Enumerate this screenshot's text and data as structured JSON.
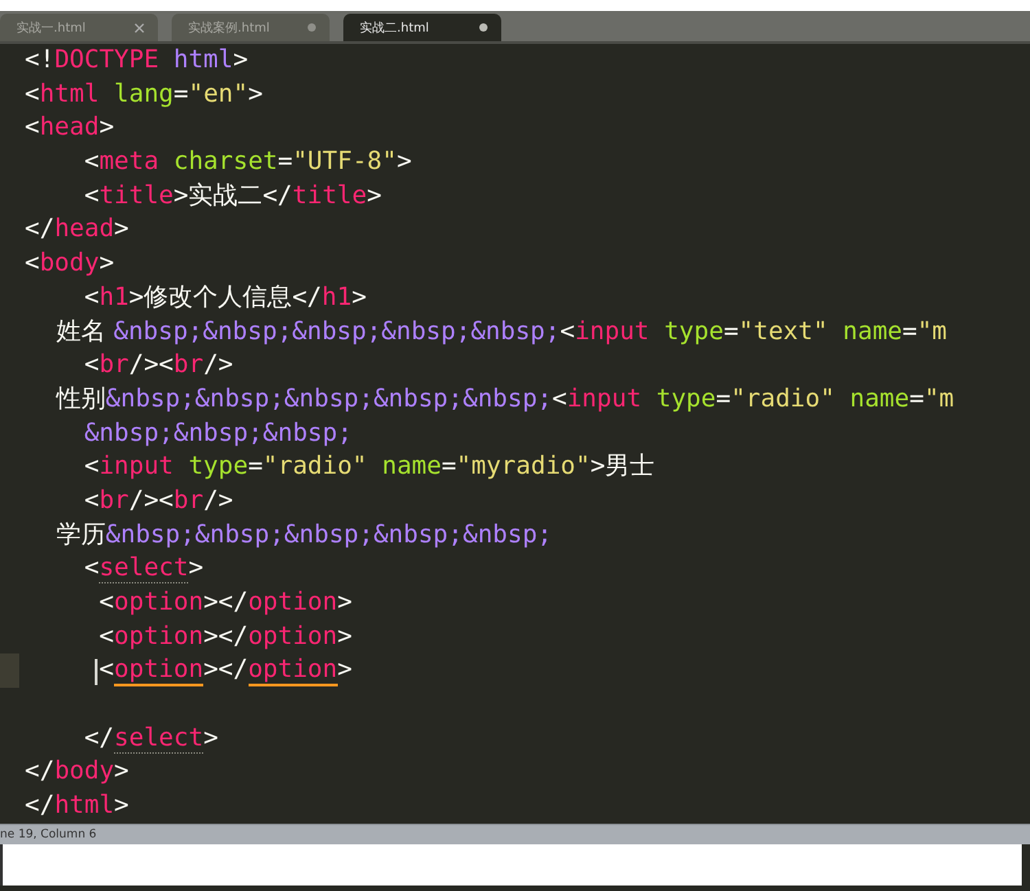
{
  "tabs": [
    {
      "label": "实战一.html",
      "selected": false,
      "modified": false
    },
    {
      "label": "实战案例.html",
      "selected": false,
      "modified": true
    },
    {
      "label": "实战二.html",
      "selected": true,
      "modified": true
    }
  ],
  "editor": {
    "lines": [
      {
        "current": false,
        "tokens": [
          {
            "kind": "punct",
            "text": "<!"
          },
          {
            "kind": "tag",
            "text": "DOCTYPE"
          },
          {
            "kind": "entity",
            "text": " html"
          },
          {
            "kind": "punct",
            "text": ">"
          }
        ]
      },
      {
        "current": false,
        "tokens": [
          {
            "kind": "punct",
            "text": "<"
          },
          {
            "kind": "tag",
            "text": "html"
          },
          {
            "kind": "attr",
            "text": " lang"
          },
          {
            "kind": "punct",
            "text": "="
          },
          {
            "kind": "string",
            "text": "\"en\""
          },
          {
            "kind": "punct",
            "text": ">"
          }
        ]
      },
      {
        "current": false,
        "tokens": [
          {
            "kind": "punct",
            "text": "<"
          },
          {
            "kind": "tag",
            "text": "head"
          },
          {
            "kind": "punct",
            "text": ">"
          }
        ]
      },
      {
        "current": false,
        "tokens": [
          {
            "kind": "punct",
            "text": "    <"
          },
          {
            "kind": "tag",
            "text": "meta"
          },
          {
            "kind": "attr",
            "text": " charset"
          },
          {
            "kind": "punct",
            "text": "="
          },
          {
            "kind": "string",
            "text": "\"UTF-8\""
          },
          {
            "kind": "punct",
            "text": ">"
          }
        ]
      },
      {
        "current": false,
        "tokens": [
          {
            "kind": "punct",
            "text": "    <"
          },
          {
            "kind": "tag",
            "text": "title"
          },
          {
            "kind": "punct",
            "text": ">"
          },
          {
            "kind": "cjk",
            "text": "实战二"
          },
          {
            "kind": "punct",
            "text": "</"
          },
          {
            "kind": "tag",
            "text": "title"
          },
          {
            "kind": "punct",
            "text": ">"
          }
        ]
      },
      {
        "current": false,
        "tokens": [
          {
            "kind": "punct",
            "text": "</"
          },
          {
            "kind": "tag",
            "text": "head"
          },
          {
            "kind": "punct",
            "text": ">"
          }
        ]
      },
      {
        "current": false,
        "tokens": [
          {
            "kind": "punct",
            "text": "<"
          },
          {
            "kind": "tag",
            "text": "body"
          },
          {
            "kind": "punct",
            "text": ">"
          }
        ]
      },
      {
        "current": false,
        "tokens": [
          {
            "kind": "punct",
            "text": "    <"
          },
          {
            "kind": "tag",
            "text": "h1"
          },
          {
            "kind": "punct",
            "text": ">"
          },
          {
            "kind": "cjk",
            "text": "修改个人信息"
          },
          {
            "kind": "punct",
            "text": "</"
          },
          {
            "kind": "tag",
            "text": "h1"
          },
          {
            "kind": "punct",
            "text": ">"
          }
        ]
      },
      {
        "current": false,
        "tokens": [
          {
            "kind": "cjk",
            "text": "    姓名 "
          },
          {
            "kind": "entity",
            "text": "&nbsp;&nbsp;&nbsp;&nbsp;&nbsp;"
          },
          {
            "kind": "punct",
            "text": "<"
          },
          {
            "kind": "tag",
            "text": "input"
          },
          {
            "kind": "attr",
            "text": " type"
          },
          {
            "kind": "punct",
            "text": "="
          },
          {
            "kind": "string",
            "text": "\"text\""
          },
          {
            "kind": "attr",
            "text": " name"
          },
          {
            "kind": "punct",
            "text": "="
          },
          {
            "kind": "string",
            "text": "\"m"
          }
        ]
      },
      {
        "current": false,
        "tokens": [
          {
            "kind": "punct",
            "text": "    <"
          },
          {
            "kind": "tag",
            "text": "br"
          },
          {
            "kind": "punct",
            "text": "/><"
          },
          {
            "kind": "tag",
            "text": "br"
          },
          {
            "kind": "punct",
            "text": "/>"
          }
        ]
      },
      {
        "current": false,
        "tokens": [
          {
            "kind": "cjk",
            "text": "    性别"
          },
          {
            "kind": "entity",
            "text": "&nbsp;&nbsp;&nbsp;&nbsp;&nbsp;"
          },
          {
            "kind": "punct",
            "text": "<"
          },
          {
            "kind": "tag",
            "text": "input"
          },
          {
            "kind": "attr",
            "text": " type"
          },
          {
            "kind": "punct",
            "text": "="
          },
          {
            "kind": "string",
            "text": "\"radio\""
          },
          {
            "kind": "attr",
            "text": " name"
          },
          {
            "kind": "punct",
            "text": "="
          },
          {
            "kind": "string",
            "text": "\"m"
          }
        ]
      },
      {
        "current": false,
        "tokens": [
          {
            "kind": "entity",
            "text": "    &nbsp;&nbsp;&nbsp;"
          }
        ]
      },
      {
        "current": false,
        "tokens": [
          {
            "kind": "punct",
            "text": "    <"
          },
          {
            "kind": "tag",
            "text": "input"
          },
          {
            "kind": "attr",
            "text": " type"
          },
          {
            "kind": "punct",
            "text": "="
          },
          {
            "kind": "string",
            "text": "\"radio\""
          },
          {
            "kind": "attr",
            "text": " name"
          },
          {
            "kind": "punct",
            "text": "="
          },
          {
            "kind": "string",
            "text": "\"myradio\""
          },
          {
            "kind": "punct",
            "text": ">"
          },
          {
            "kind": "cjk",
            "text": "男士"
          }
        ]
      },
      {
        "current": false,
        "tokens": [
          {
            "kind": "punct",
            "text": "    <"
          },
          {
            "kind": "tag",
            "text": "br"
          },
          {
            "kind": "punct",
            "text": "/><"
          },
          {
            "kind": "tag",
            "text": "br"
          },
          {
            "kind": "punct",
            "text": "/>"
          }
        ]
      },
      {
        "current": false,
        "tokens": [
          {
            "kind": "cjk",
            "text": "    学历"
          },
          {
            "kind": "entity",
            "text": "&nbsp;&nbsp;&nbsp;&nbsp;&nbsp;"
          }
        ]
      },
      {
        "current": false,
        "tokens": [
          {
            "kind": "punct",
            "text": "    <"
          },
          {
            "kind": "tag",
            "text": "select",
            "dotted_underline": true
          },
          {
            "kind": "punct",
            "text": ">"
          }
        ]
      },
      {
        "current": false,
        "tokens": [
          {
            "kind": "punct",
            "text": "     <"
          },
          {
            "kind": "tag",
            "text": "option"
          },
          {
            "kind": "punct",
            "text": "></"
          },
          {
            "kind": "tag",
            "text": "option"
          },
          {
            "kind": "punct",
            "text": ">"
          }
        ]
      },
      {
        "current": false,
        "tokens": [
          {
            "kind": "punct",
            "text": "     <"
          },
          {
            "kind": "tag",
            "text": "option"
          },
          {
            "kind": "punct",
            "text": "></"
          },
          {
            "kind": "tag",
            "text": "option"
          },
          {
            "kind": "punct",
            "text": ">"
          }
        ]
      },
      {
        "current": true,
        "tokens": [
          {
            "kind": "punct",
            "text": "     <",
            "caret": true
          },
          {
            "kind": "tag",
            "text": "option",
            "orange_underline": true
          },
          {
            "kind": "punct",
            "text": "></"
          },
          {
            "kind": "tag",
            "text": "option",
            "orange_underline": true
          },
          {
            "kind": "punct",
            "text": ">"
          }
        ]
      },
      {
        "current": false
      },
      {
        "current": false,
        "tokens": [
          {
            "kind": "punct",
            "text": "    </"
          },
          {
            "kind": "tag",
            "text": "select",
            "dotted_underline": true
          },
          {
            "kind": "punct",
            "text": ">"
          }
        ]
      },
      {
        "current": false,
        "tokens": [
          {
            "kind": "punct",
            "text": "</"
          },
          {
            "kind": "tag",
            "text": "body"
          },
          {
            "kind": "punct",
            "text": ">"
          }
        ]
      },
      {
        "current": false,
        "tokens": [
          {
            "kind": "punct",
            "text": "</"
          },
          {
            "kind": "tag",
            "text": "html"
          },
          {
            "kind": "punct",
            "text": ">"
          }
        ]
      }
    ]
  },
  "status_bar": {
    "text": "ne 19, Column 6"
  }
}
